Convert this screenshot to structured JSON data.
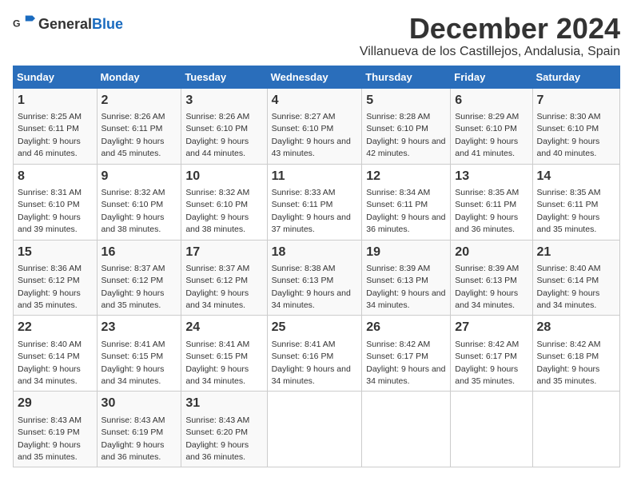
{
  "logo": {
    "text_general": "General",
    "text_blue": "Blue"
  },
  "title": "December 2024",
  "subtitle": "Villanueva de los Castillejos, Andalusia, Spain",
  "days_of_week": [
    "Sunday",
    "Monday",
    "Tuesday",
    "Wednesday",
    "Thursday",
    "Friday",
    "Saturday"
  ],
  "weeks": [
    [
      {
        "day": "1",
        "sunrise": "8:25 AM",
        "sunset": "6:11 PM",
        "daylight": "9 hours and 46 minutes."
      },
      {
        "day": "2",
        "sunrise": "8:26 AM",
        "sunset": "6:11 PM",
        "daylight": "9 hours and 45 minutes."
      },
      {
        "day": "3",
        "sunrise": "8:26 AM",
        "sunset": "6:10 PM",
        "daylight": "9 hours and 44 minutes."
      },
      {
        "day": "4",
        "sunrise": "8:27 AM",
        "sunset": "6:10 PM",
        "daylight": "9 hours and 43 minutes."
      },
      {
        "day": "5",
        "sunrise": "8:28 AM",
        "sunset": "6:10 PM",
        "daylight": "9 hours and 42 minutes."
      },
      {
        "day": "6",
        "sunrise": "8:29 AM",
        "sunset": "6:10 PM",
        "daylight": "9 hours and 41 minutes."
      },
      {
        "day": "7",
        "sunrise": "8:30 AM",
        "sunset": "6:10 PM",
        "daylight": "9 hours and 40 minutes."
      }
    ],
    [
      {
        "day": "8",
        "sunrise": "8:31 AM",
        "sunset": "6:10 PM",
        "daylight": "9 hours and 39 minutes."
      },
      {
        "day": "9",
        "sunrise": "8:32 AM",
        "sunset": "6:10 PM",
        "daylight": "9 hours and 38 minutes."
      },
      {
        "day": "10",
        "sunrise": "8:32 AM",
        "sunset": "6:10 PM",
        "daylight": "9 hours and 38 minutes."
      },
      {
        "day": "11",
        "sunrise": "8:33 AM",
        "sunset": "6:11 PM",
        "daylight": "9 hours and 37 minutes."
      },
      {
        "day": "12",
        "sunrise": "8:34 AM",
        "sunset": "6:11 PM",
        "daylight": "9 hours and 36 minutes."
      },
      {
        "day": "13",
        "sunrise": "8:35 AM",
        "sunset": "6:11 PM",
        "daylight": "9 hours and 36 minutes."
      },
      {
        "day": "14",
        "sunrise": "8:35 AM",
        "sunset": "6:11 PM",
        "daylight": "9 hours and 35 minutes."
      }
    ],
    [
      {
        "day": "15",
        "sunrise": "8:36 AM",
        "sunset": "6:12 PM",
        "daylight": "9 hours and 35 minutes."
      },
      {
        "day": "16",
        "sunrise": "8:37 AM",
        "sunset": "6:12 PM",
        "daylight": "9 hours and 35 minutes."
      },
      {
        "day": "17",
        "sunrise": "8:37 AM",
        "sunset": "6:12 PM",
        "daylight": "9 hours and 34 minutes."
      },
      {
        "day": "18",
        "sunrise": "8:38 AM",
        "sunset": "6:13 PM",
        "daylight": "9 hours and 34 minutes."
      },
      {
        "day": "19",
        "sunrise": "8:39 AM",
        "sunset": "6:13 PM",
        "daylight": "9 hours and 34 minutes."
      },
      {
        "day": "20",
        "sunrise": "8:39 AM",
        "sunset": "6:13 PM",
        "daylight": "9 hours and 34 minutes."
      },
      {
        "day": "21",
        "sunrise": "8:40 AM",
        "sunset": "6:14 PM",
        "daylight": "9 hours and 34 minutes."
      }
    ],
    [
      {
        "day": "22",
        "sunrise": "8:40 AM",
        "sunset": "6:14 PM",
        "daylight": "9 hours and 34 minutes."
      },
      {
        "day": "23",
        "sunrise": "8:41 AM",
        "sunset": "6:15 PM",
        "daylight": "9 hours and 34 minutes."
      },
      {
        "day": "24",
        "sunrise": "8:41 AM",
        "sunset": "6:15 PM",
        "daylight": "9 hours and 34 minutes."
      },
      {
        "day": "25",
        "sunrise": "8:41 AM",
        "sunset": "6:16 PM",
        "daylight": "9 hours and 34 minutes."
      },
      {
        "day": "26",
        "sunrise": "8:42 AM",
        "sunset": "6:17 PM",
        "daylight": "9 hours and 34 minutes."
      },
      {
        "day": "27",
        "sunrise": "8:42 AM",
        "sunset": "6:17 PM",
        "daylight": "9 hours and 35 minutes."
      },
      {
        "day": "28",
        "sunrise": "8:42 AM",
        "sunset": "6:18 PM",
        "daylight": "9 hours and 35 minutes."
      }
    ],
    [
      {
        "day": "29",
        "sunrise": "8:43 AM",
        "sunset": "6:19 PM",
        "daylight": "9 hours and 35 minutes."
      },
      {
        "day": "30",
        "sunrise": "8:43 AM",
        "sunset": "6:19 PM",
        "daylight": "9 hours and 36 minutes."
      },
      {
        "day": "31",
        "sunrise": "8:43 AM",
        "sunset": "6:20 PM",
        "daylight": "9 hours and 36 minutes."
      },
      null,
      null,
      null,
      null
    ]
  ]
}
